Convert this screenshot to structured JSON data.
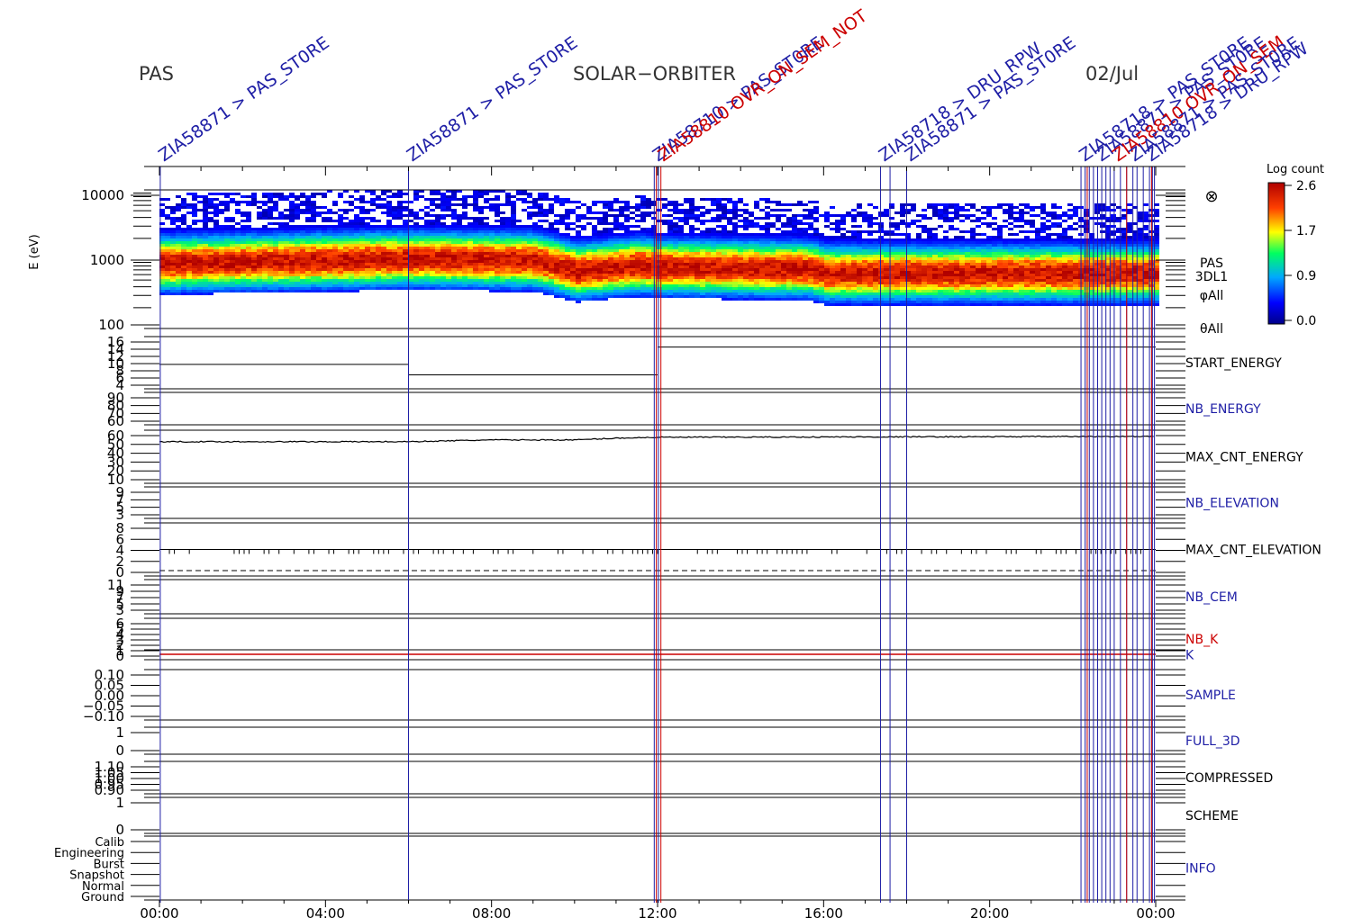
{
  "header": {
    "instrument": "PAS",
    "mission": "SOLAR−ORBITER",
    "date": "02/Jul"
  },
  "colorbar": {
    "title": "Log count",
    "ticks": [
      "2.6",
      "1.7",
      "0.9",
      "0.0"
    ]
  },
  "chart_data": {
    "type": "heatmap",
    "x_axis": {
      "tick_labels": [
        "00:00",
        "04:00",
        "08:00",
        "12:00",
        "16:00",
        "20:00",
        "00:00"
      ],
      "range_hours": [
        0,
        24
      ]
    },
    "panels": [
      {
        "name": "spectrogram",
        "ylabel": "E (eV)",
        "yscale": "log",
        "ytick_labels": [
          "10000",
          "1000",
          "100"
        ],
        "right_labels": [
          "⊗",
          "PAS",
          "3DL1",
          "φAll",
          "θAll"
        ],
        "peak_energy_ev_by_hour": [
          [
            0,
            900
          ],
          [
            6,
            1050
          ],
          [
            9,
            1000
          ],
          [
            10,
            700
          ],
          [
            11.5,
            850
          ],
          [
            12,
            800
          ],
          [
            15.6,
            750
          ],
          [
            16,
            650
          ],
          [
            24,
            650
          ]
        ]
      },
      {
        "name": "START_ENERGY",
        "label_color": "#000000",
        "ytick_labels": [
          "16",
          "14",
          "12",
          "10",
          "8",
          "6",
          "4"
        ],
        "levels": [
          [
            0,
            9
          ],
          [
            6,
            6
          ],
          [
            12,
            14
          ]
        ]
      },
      {
        "name": "NB_ENERGY",
        "label_color": "#1f1fa6",
        "ytick_labels": [
          "90",
          "80",
          "70",
          "60"
        ]
      },
      {
        "name": "MAX_CNT_ENERGY",
        "label_color": "#000000",
        "ytick_labels": [
          "60",
          "50",
          "40",
          "30",
          "20",
          "10"
        ],
        "values_by_hour": [
          [
            0,
            52
          ],
          [
            6,
            52
          ],
          [
            8,
            54
          ],
          [
            10,
            54
          ],
          [
            11,
            56
          ],
          [
            12,
            57
          ],
          [
            24,
            58
          ]
        ]
      },
      {
        "name": "NB_ELEVATION",
        "label_color": "#1f1fa6",
        "ytick_labels": [
          "9",
          "7",
          "5",
          "3"
        ]
      },
      {
        "name": "MAX_CNT_ELEVATION",
        "label_color": "#000000",
        "ytick_labels": [
          "8",
          "6",
          "4",
          "2",
          "0"
        ],
        "baseline": 4
      },
      {
        "name": "NB_CEM",
        "label_color": "#1f1fa6",
        "ytick_labels": [
          "11",
          "9",
          "7",
          "5",
          "3"
        ]
      },
      {
        "name": "NB_K",
        "label_color": "#cc0000",
        "ytick_labels": [
          "6",
          "5",
          "4",
          "3",
          "2",
          "1",
          "0"
        ]
      },
      {
        "name": "K",
        "label_color": "#1f1fa6",
        "value": 1
      },
      {
        "name": "SAMPLE",
        "label_color": "#1f1fa6",
        "ytick_labels": [
          "0.10",
          "0.05",
          "0.00",
          "−0.05",
          "−0.10"
        ]
      },
      {
        "name": "FULL_3D",
        "label_color": "#1f1fa6",
        "ytick_labels": [
          "1",
          "0"
        ]
      },
      {
        "name": "COMPRESSED",
        "label_color": "#000000",
        "ytick_labels": [
          "1.10",
          "1.05",
          "1.00",
          "0.95",
          "0.90"
        ]
      },
      {
        "name": "SCHEME",
        "label_color": "#000000",
        "ytick_labels": [
          "1",
          "0"
        ]
      },
      {
        "name": "INFO",
        "label_color": "#1f1fa6",
        "ytick_labels": [
          "Calib",
          "Engineering",
          "Burst",
          "Snapshot",
          "Normal",
          "Ground"
        ]
      }
    ],
    "event_markers": {
      "blue_hours": [
        0.02,
        6.0,
        11.92,
        12.02,
        17.37,
        17.6,
        18.0,
        22.2,
        22.3,
        22.4,
        22.5,
        22.6,
        22.7,
        22.8,
        22.9,
        23.0,
        23.15,
        23.3,
        23.45,
        23.55,
        23.7,
        23.85,
        23.92,
        23.97
      ],
      "red_hours": [
        11.97,
        12.08,
        22.35,
        23.3,
        23.9
      ],
      "labels": [
        {
          "hour": 0.02,
          "text": "ZIA58871 > PAS_ST0RE",
          "color": "#1f1fa6"
        },
        {
          "hour": 6.0,
          "text": "ZIA58871 > PAS_ST0RE",
          "color": "#1f1fa6"
        },
        {
          "hour": 11.92,
          "text": "ZIA58710 > PAS_ST0RE",
          "color": "#1f1fa6"
        },
        {
          "hour": 12.05,
          "text": "ZIA58810 OVR_ON_SEM_NOT",
          "color": "#cc0000"
        },
        {
          "hour": 17.37,
          "text": "ZIA58718 > DRU_RPW",
          "color": "#1f1fa6"
        },
        {
          "hour": 18.0,
          "text": "ZIA58871 > PAS_ST0RE",
          "color": "#1f1fa6"
        },
        {
          "hour": 22.2,
          "text": "ZIA58718 > PAS_ST0RE",
          "color": "#1f1fa6"
        },
        {
          "hour": 22.6,
          "text": "ZIA58871 > PAS_ST0RE",
          "color": "#1f1fa6"
        },
        {
          "hour": 23.0,
          "text": "ZIA58810 OVR_ON_SEM",
          "color": "#cc0000"
        },
        {
          "hour": 23.4,
          "text": "ZIA58871 > PAS_ST0RE",
          "color": "#1f1fa6"
        },
        {
          "hour": 23.8,
          "text": "ZIA58718 > DRU_RPW",
          "color": "#1f1fa6"
        }
      ]
    }
  }
}
